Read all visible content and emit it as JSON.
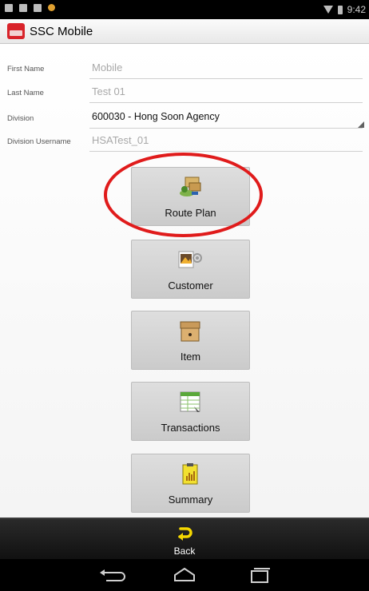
{
  "status_bar": {
    "time": "9:42"
  },
  "app": {
    "title": "SSC Mobile"
  },
  "form": {
    "first_name": {
      "label": "First Name",
      "value": "Mobile"
    },
    "last_name": {
      "label": "Last Name",
      "value": "Test 01"
    },
    "division": {
      "label": "Division",
      "value": "600030 - Hong Soon Agency"
    },
    "division_username": {
      "label": "Division Username",
      "value": "HSATest_01"
    }
  },
  "menu": {
    "items": [
      {
        "label": "Route Plan",
        "icon": "route-plan-icon"
      },
      {
        "label": "Customer",
        "icon": "customer-contact-icon"
      },
      {
        "label": "Item",
        "icon": "item-box-icon"
      },
      {
        "label": "Transactions",
        "icon": "transactions-sheet-icon"
      },
      {
        "label": "Summary",
        "icon": "summary-clipboard-icon"
      }
    ]
  },
  "action_bar": {
    "back_label": "Back"
  },
  "colors": {
    "highlight_ring": "#e01b1b",
    "app_logo": "#d8232a",
    "back_arrow": "#f5d800"
  }
}
